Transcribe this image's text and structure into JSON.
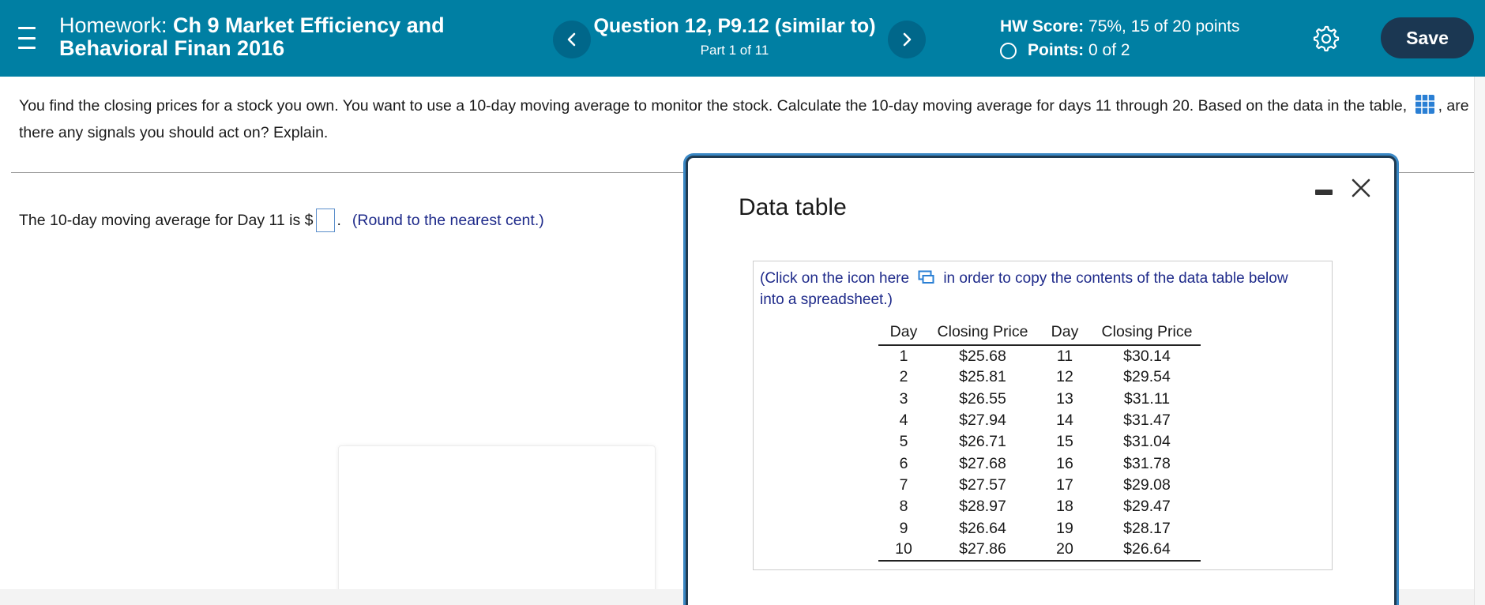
{
  "header": {
    "title_prefix": "Homework:",
    "title_bold_line1": "Ch 9 Market Efficiency and",
    "title_bold_line2": "Behavioral Finan 2016",
    "question_title": "Question 12, P9.12 (similar to)",
    "question_part": "Part 1 of 11",
    "score_label": "HW Score:",
    "score_value": "75%, 15 of 20 points",
    "points_label": "Points:",
    "points_value": "0 of 2",
    "save_label": "Save",
    "prev_icon": "chevron-left-icon",
    "next_icon": "chevron-right-icon",
    "settings_icon": "gear-icon",
    "menu_icon": "hamburger-menu-icon",
    "brand_color": "#007fa3",
    "save_color": "#1b3752"
  },
  "question": {
    "text_before_icon": "You find the closing prices for a stock you own. You want to use a 10-day moving average to monitor the stock. Calculate the 10-day moving average for days 11 through 20. Based on the data in the table,",
    "text_after_icon": ", are there any signals you should act on? Explain.",
    "table_icon": "table-grid-icon"
  },
  "answer": {
    "prefix": "The 10-day moving average for Day 11 is $",
    "suffix": ".",
    "input_value": "",
    "hint": "(Round to the nearest cent.)"
  },
  "dialog": {
    "title": "Data table",
    "copy_note_before": "(Click on the icon here",
    "copy_note_after": "in order to copy the contents of the data table below into a spreadsheet.)",
    "headers": [
      "Day",
      "Closing Price",
      "Day",
      "Closing Price"
    ],
    "rows": [
      [
        "1",
        "$25.68",
        "11",
        "$30.14"
      ],
      [
        "2",
        "$25.81",
        "12",
        "$29.54"
      ],
      [
        "3",
        "$26.55",
        "13",
        "$31.11"
      ],
      [
        "4",
        "$27.94",
        "14",
        "$31.47"
      ],
      [
        "5",
        "$26.71",
        "15",
        "$31.04"
      ],
      [
        "6",
        "$27.68",
        "16",
        "$31.78"
      ],
      [
        "7",
        "$27.57",
        "17",
        "$29.08"
      ],
      [
        "8",
        "$28.97",
        "18",
        "$29.47"
      ],
      [
        "9",
        "$26.64",
        "19",
        "$28.17"
      ],
      [
        "10",
        "$27.86",
        "20",
        "$26.64"
      ]
    ]
  }
}
